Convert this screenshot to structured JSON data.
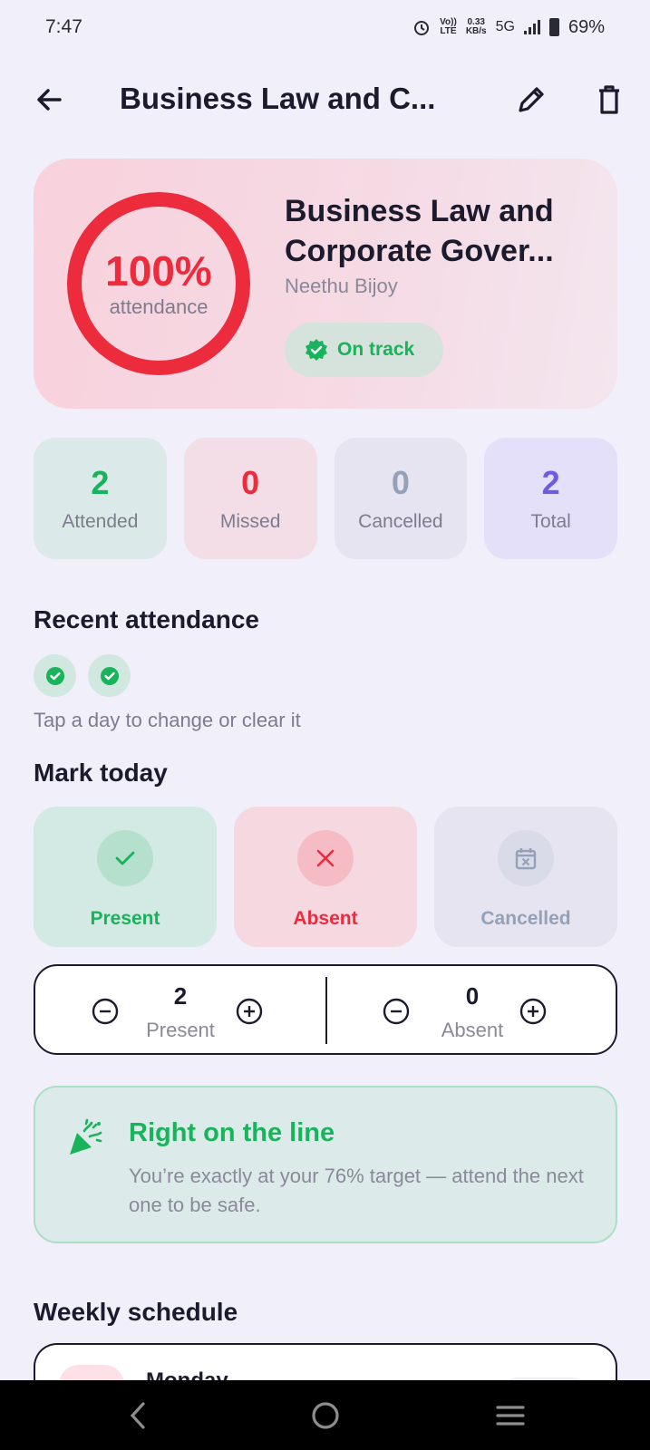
{
  "status_bar": {
    "time": "7:47",
    "lte_top": "Vo))",
    "lte_bottom": "LTE",
    "speed_top": "0.33",
    "speed_bottom": "KB/s",
    "network": "5G",
    "battery": "69%"
  },
  "app_bar": {
    "title": "Business Law and C...",
    "back_icon": "arrow-left-icon",
    "edit_icon": "pencil-icon",
    "delete_icon": "trash-icon"
  },
  "hero": {
    "percent": "100%",
    "percent_value": 1.0,
    "percent_label": "attendance",
    "title_line1": "Business Law and",
    "title_line2": "Corporate Gover...",
    "instructor": "Neethu Bijoy",
    "badge": "On track",
    "ring_color": "#ec2b3d"
  },
  "stats": [
    {
      "value": "2",
      "label": "Attended"
    },
    {
      "value": "0",
      "label": "Missed"
    },
    {
      "value": "0",
      "label": "Cancelled"
    },
    {
      "value": "2",
      "label": "Total"
    }
  ],
  "recent": {
    "heading": "Recent attendance",
    "days": [
      "present",
      "present"
    ],
    "hint": "Tap a day to change or clear it"
  },
  "mark_today": {
    "heading": "Mark today",
    "present": "Present",
    "absent": "Absent",
    "cancelled": "Cancelled"
  },
  "counters": {
    "present_value": "2",
    "present_label": "Present",
    "absent_value": "0",
    "absent_label": "Absent"
  },
  "callout": {
    "title": "Right on the line",
    "body": "You’re exactly at your 76% target — attend the next one to be safe."
  },
  "schedule": {
    "heading": "Weekly schedule",
    "first_day": "Monday"
  },
  "colors": {
    "green": "#18b35a",
    "red": "#ec2b3d",
    "purple": "#6e5ce0",
    "grey_blue": "#95a1b8"
  }
}
